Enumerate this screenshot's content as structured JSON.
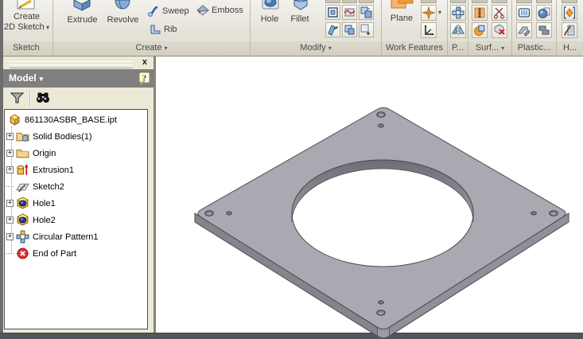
{
  "ribbon": {
    "arrow_glyph": "▾",
    "panels": [
      {
        "title": "Sketch"
      },
      {
        "title": "Create"
      },
      {
        "title": "Modify"
      },
      {
        "title": "Work Features"
      },
      {
        "title": "P..."
      },
      {
        "title": "Surf..."
      },
      {
        "title": "Plastic..."
      },
      {
        "title": "H..."
      }
    ],
    "buttons": {
      "create_2d_line1": "Create",
      "create_2d_line2": "2D Sketch",
      "extrude": "Extrude",
      "revolve": "Revolve",
      "sweep": "Sweep",
      "rib": "Rib",
      "emboss": "Emboss",
      "hole": "Hole",
      "fillet": "Fillet",
      "plane": "Plane"
    }
  },
  "browser": {
    "title": "Model",
    "title_arrow": "▾",
    "close_glyph": "x",
    "help_glyph": "?",
    "expander_glyph": "+",
    "tree": [
      {
        "label": "861130ASBR_BASE.ipt",
        "icon": "part"
      },
      {
        "label": "Solid Bodies(1)",
        "icon": "solid-bodies-folder",
        "expandable": true
      },
      {
        "label": "Origin",
        "icon": "folder",
        "expandable": true
      },
      {
        "label": "Extrusion1",
        "icon": "extrusion",
        "expandable": true
      },
      {
        "label": "Sketch2",
        "icon": "sketch"
      },
      {
        "label": "Hole1",
        "icon": "hole",
        "expandable": true
      },
      {
        "label": "Hole2",
        "icon": "hole",
        "expandable": true
      },
      {
        "label": "Circular Pattern1",
        "icon": "circular-pattern",
        "expandable": true
      },
      {
        "label": "End of Part",
        "icon": "end-of-part"
      }
    ]
  },
  "viewport": {
    "content": "isometric gray square plate with large central through-hole and two small holes near each corner",
    "model_colors": {
      "top_face": "#a9a9b1",
      "side_left": "#84848c",
      "side_right": "#8f8f97",
      "outline": "#4a4a50",
      "hole_wall_dark": "#6e6e76",
      "hole_wall_light": "#9c9ca4",
      "background": "#ffffff"
    }
  }
}
